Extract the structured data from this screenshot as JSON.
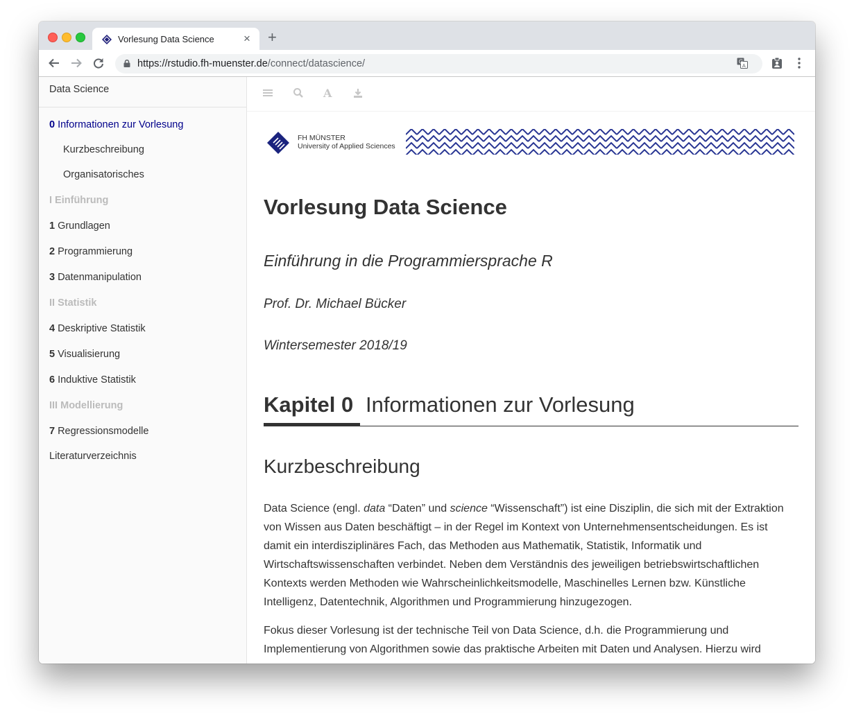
{
  "browser": {
    "tab_title": "Vorlesung Data Science",
    "url_host": "https://rstudio.fh-muenster.de",
    "url_path": "/connect/datascience/"
  },
  "sidebar": {
    "title": "Data Science",
    "items": [
      {
        "num": "0",
        "label": "Informationen zur Vorlesung",
        "kind": "chapter",
        "active": true
      },
      {
        "num": "",
        "label": "Kurzbeschreibung",
        "kind": "section"
      },
      {
        "num": "",
        "label": "Organisatorisches",
        "kind": "section"
      },
      {
        "num": "",
        "label": "I Einführung",
        "kind": "part"
      },
      {
        "num": "1",
        "label": "Grundlagen",
        "kind": "chapter"
      },
      {
        "num": "2",
        "label": "Programmierung",
        "kind": "chapter"
      },
      {
        "num": "3",
        "label": "Datenmanipulation",
        "kind": "chapter"
      },
      {
        "num": "",
        "label": "II Statistik",
        "kind": "part"
      },
      {
        "num": "4",
        "label": "Deskriptive Statistik",
        "kind": "chapter"
      },
      {
        "num": "5",
        "label": "Visualisierung",
        "kind": "chapter"
      },
      {
        "num": "6",
        "label": "Induktive Statistik",
        "kind": "chapter"
      },
      {
        "num": "",
        "label": "III Modellierung",
        "kind": "part"
      },
      {
        "num": "7",
        "label": "Regressionsmodelle",
        "kind": "chapter"
      },
      {
        "num": "",
        "label": "Literaturverzeichnis",
        "kind": "chapter"
      }
    ]
  },
  "toolbar_icons": [
    "menu-icon",
    "search-icon",
    "font-icon",
    "download-icon"
  ],
  "banner": {
    "line1": "FH MÜNSTER",
    "line2": "University of Applied Sciences"
  },
  "main": {
    "title": "Vorlesung Data Science",
    "subtitle": "Einführung in die Programmiersprache R",
    "author": "Prof. Dr. Michael Bücker",
    "date": "Wintersemester 2018/19",
    "chapter_num": "Kapitel 0",
    "chapter_title": "Informationen zur Vorlesung",
    "section": "Kurzbeschreibung",
    "para1": {
      "t1": "Data Science (engl. ",
      "em1": "data",
      "t2": " “Daten” und ",
      "em2": "science",
      "t3": " “Wissenschaft”) ist eine Disziplin, die sich mit der Extraktion von Wissen aus Daten beschäftigt – in der Regel im Kontext von Unternehmensentscheidungen. Es ist damit ein interdisziplinäres Fach, das Methoden aus Mathematik, Statistik, Informatik und Wirtschaftswissenschaften verbindet. Neben dem Verständnis des jeweiligen betriebswirtschaftlichen Kontexts werden Methoden wie Wahrscheinlichkeitsmodelle, Maschinelles Lernen bzw. Künstliche Intelligenz, Datentechnik, Algorithmen und Programmierung hinzugezogen."
    },
    "para2": "Fokus dieser Vorlesung ist der technische Teil von Data Science, d.h. die Programmierung und Implementierung von Algorithmen sowie das praktische Arbeiten mit Daten und Analysen. Hierzu wird"
  }
}
